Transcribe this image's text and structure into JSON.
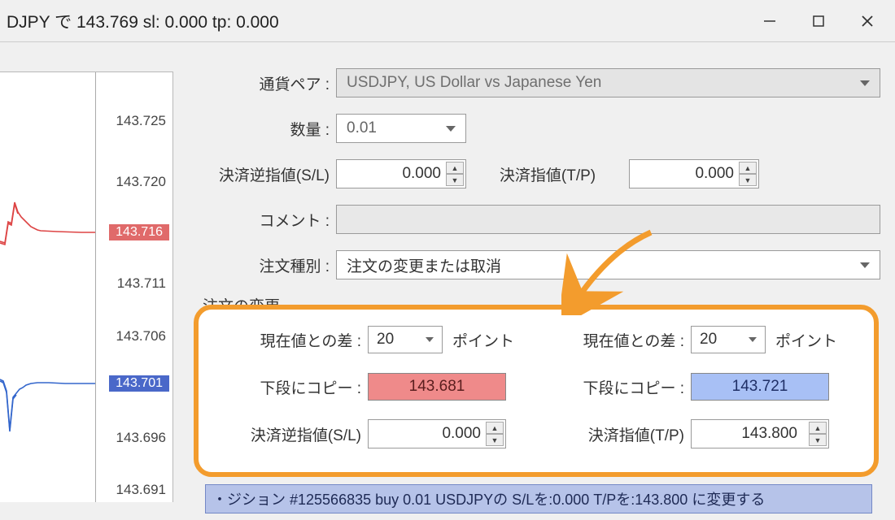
{
  "titlebar": {
    "title": "DJPY で 143.769 sl: 0.000 tp: 0.000"
  },
  "chart": {
    "ticks": [
      "143.725",
      "143.720",
      "143.711",
      "143.706",
      "143.696",
      "143.691"
    ],
    "ask_tag": "143.716",
    "bid_tag": "143.701"
  },
  "form": {
    "symbol_label": "通貨ペア :",
    "symbol_value": "USDJPY, US Dollar vs Japanese Yen",
    "volume_label": "数量 :",
    "volume_value": "0.01",
    "sl_label": "決済逆指値(S/L)",
    "sl_value": "0.000",
    "tp_label": "決済指値(T/P)",
    "tp_value": "0.000",
    "comment_label": "コメント :",
    "comment_value": "",
    "ordertype_label": "注文種別 :",
    "ordertype_value": "注文の変更または取消",
    "section_modify": "注文の変更"
  },
  "highlight": {
    "diff_label": "現在値との差 :",
    "diff_value_left": "20",
    "diff_value_right": "20",
    "unit": "ポイント",
    "copy_label": "下段にコピー :",
    "copy_value_left": "143.681",
    "copy_value_right": "143.721",
    "sl_label": "決済逆指値(S/L)",
    "sl_value": "0.000",
    "tp_label": "決済指値(T/P)",
    "tp_value": "143.800"
  },
  "action_button": "・ジション #125566835 buy 0.01 USDJPYの S/Lを:0.000 T/Pを:143.800 に変更する"
}
